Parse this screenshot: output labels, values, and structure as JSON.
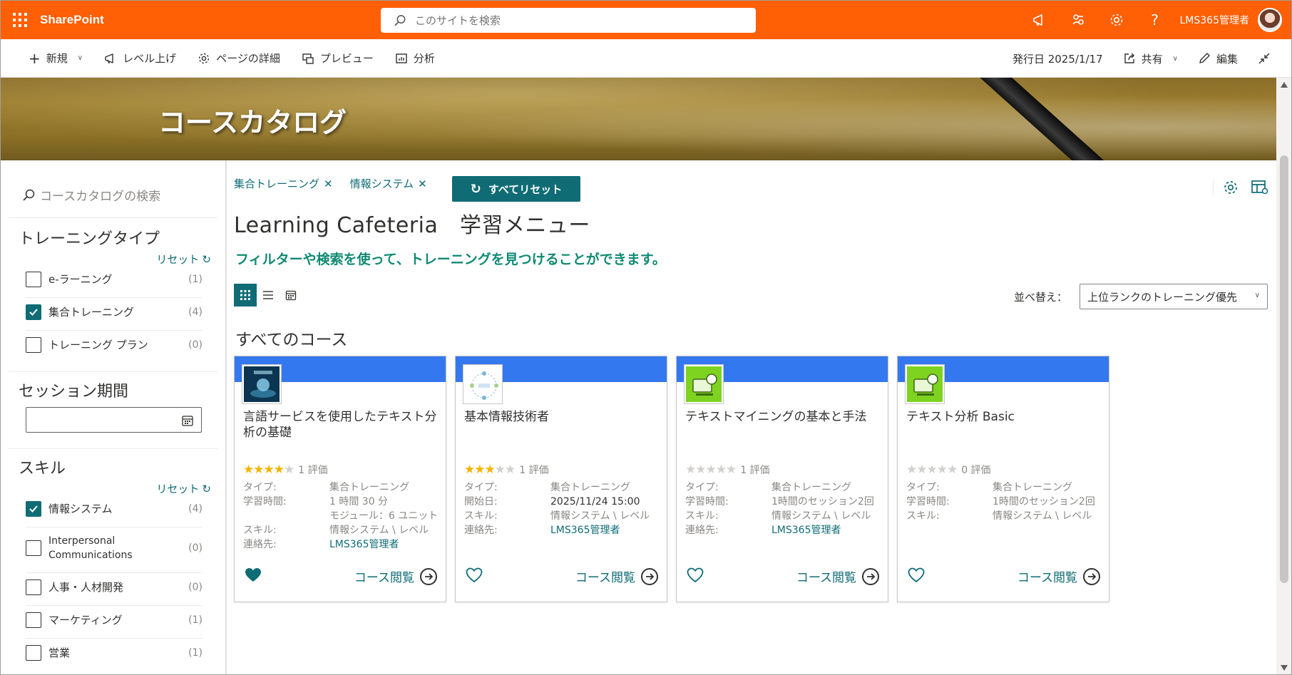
{
  "suitebar": {
    "brand": "SharePoint",
    "search_placeholder": "このサイトを検索",
    "user_name": "LMS365管理者",
    "colors": {
      "background": "#ff5f05"
    },
    "icons": [
      "megaphone-icon",
      "share-network-icon",
      "gear-icon",
      "help-icon"
    ]
  },
  "commandbar": {
    "new_label": "新規",
    "promote_label": "レベル上げ",
    "page_details_label": "ページの詳細",
    "preview_label": "プレビュー",
    "analytics_label": "分析",
    "published_label": "発行日 2025/1/17",
    "share_label": "共有",
    "edit_label": "編集"
  },
  "banner": {
    "title": "コースカタログ"
  },
  "filters": {
    "search_placeholder": "コースカタログの検索",
    "training_type": {
      "title": "トレーニングタイプ",
      "reset_label": "リセット",
      "items": [
        {
          "label": "e-ラーニング",
          "count": "(1)",
          "checked": false
        },
        {
          "label": "集合トレーニング",
          "count": "(4)",
          "checked": true
        },
        {
          "label": "トレーニング プラン",
          "count": "(0)",
          "checked": false
        }
      ]
    },
    "session_period": {
      "title": "セッション期間"
    },
    "skills": {
      "title": "スキル",
      "reset_label": "リセット",
      "items": [
        {
          "label": "情報システム",
          "count": "(4)",
          "checked": true
        },
        {
          "label": "Interpersonal Communications",
          "count": "(0)",
          "checked": false
        },
        {
          "label": "人事・人材開発",
          "count": "(0)",
          "checked": false
        },
        {
          "label": "マーケティング",
          "count": "(1)",
          "checked": false
        },
        {
          "label": "営業",
          "count": "(1)",
          "checked": false
        }
      ]
    }
  },
  "main": {
    "chips": [
      "集合トレーニング",
      "情報システム"
    ],
    "reset_all_label": "すべてリセット",
    "title": "Learning Cafeteria　学習メニュー",
    "subtitle": "フィルターや検索を使って、トレーニングを見つけることができます。",
    "sort_label": "並べ替え：",
    "sort_value": "上位ランクのトレーニング優先",
    "section_heading": "すべてのコース",
    "browse_label": "コース閲覧",
    "accent_color": "#0f6c75",
    "cards": [
      {
        "title": "言語サービスを使用したテキスト分析の基礎",
        "stars": 4,
        "rating_text": "1 評価",
        "favorite": true,
        "meta": [
          {
            "key": "タイプ:",
            "value": "集合トレーニング"
          },
          {
            "key": "学習時間:",
            "value": "1 時間 30 分"
          },
          {
            "key": "",
            "value": "モジュール：6 ユニット"
          },
          {
            "key": "スキル:",
            "value": "情報システム \\ レベル"
          },
          {
            "key": "連絡先:",
            "value": "LMS365管理者",
            "link": true
          }
        ]
      },
      {
        "title": "基本情報技術者",
        "stars": 3,
        "rating_text": "1 評価",
        "favorite": false,
        "meta": [
          {
            "key": "タイプ:",
            "value": "集合トレーニング"
          },
          {
            "key": "開始日:",
            "value": "2025/11/24 15:00"
          },
          {
            "key": "スキル:",
            "value": "情報システム \\ レベル"
          },
          {
            "key": "連絡先:",
            "value": "LMS365管理者",
            "link": true
          }
        ]
      },
      {
        "title": "テキストマイニングの基本と手法",
        "stars": 0,
        "rating_text": "1 評価",
        "favorite": false,
        "meta": [
          {
            "key": "タイプ:",
            "value": "集合トレーニング"
          },
          {
            "key": "学習時間:",
            "value": "1時間のセッション2回"
          },
          {
            "key": "スキル:",
            "value": "情報システム \\ レベル"
          },
          {
            "key": "連絡先:",
            "value": "LMS365管理者",
            "link": true
          }
        ]
      },
      {
        "title": "テキスト分析 Basic",
        "stars": 0,
        "rating_text": "0 評価",
        "favorite": false,
        "meta": [
          {
            "key": "タイプ:",
            "value": "集合トレーニング"
          },
          {
            "key": "学習時間:",
            "value": "1時間のセッション2回"
          },
          {
            "key": "スキル:",
            "value": "情報システム \\ レベル"
          }
        ]
      }
    ]
  }
}
